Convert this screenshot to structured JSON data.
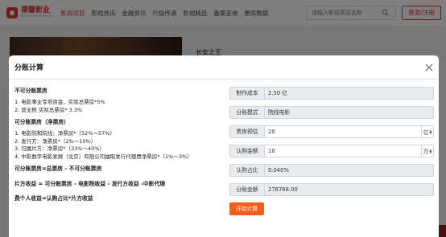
{
  "brand": {
    "name_cn": "德馨影业",
    "name_en": "DEXIN FILMS GROUP"
  },
  "nav": {
    "items": [
      {
        "label": "影视项目",
        "active": true
      },
      {
        "label": "影视资讯",
        "active": false
      },
      {
        "label": "金融资讯",
        "active": false
      },
      {
        "label": "行投传递",
        "active": false
      },
      {
        "label": "影视精选",
        "active": false
      },
      {
        "label": "备案查询",
        "active": false
      },
      {
        "label": "票房数据",
        "active": false
      }
    ],
    "search_placeholder": "请输入影视项目名称",
    "login_label": "登录/注册"
  },
  "background": {
    "project_title": "长安之王"
  },
  "modal": {
    "title": "分账计算",
    "sections": {
      "non_split_title": "不可分账票房",
      "non_split_lines": [
        "1. 电影事业专项资金，实际总票房*5%",
        "2. 营业税 实际总票房* 3.3%"
      ],
      "split_title": "可分账票房（净票房）",
      "split_lines": [
        "1. 电影院和院线：净票房*（52%～57%）",
        "2. 发行方：净票房*（2%～10%）",
        "3. 归属片方：净票房*（33%～40%）",
        "4. 中影数字电影发展（北京）有限公司抽取发行代理费净票房*（1%～3%）"
      ],
      "formula1": "可分账票房=总票房 - 不可分账票房",
      "formula2": "片方收益 = 可分账票房 - 电影院收益 - 发行方收益 -中影代理",
      "formula3": "费个人收益=认购占比*片方收益"
    },
    "form": {
      "cost_label": "制作成本",
      "cost_value": "2.50 亿",
      "mode_label": "分账模式",
      "mode_value": "院线电影",
      "box_label": "票房预估",
      "box_value": "20",
      "box_unit": "亿",
      "subscribe_label": "认购金额",
      "subscribe_value": "10",
      "subscribe_unit": "万",
      "ratio_label": "认购占比",
      "ratio_value": "0.040%",
      "split_amount_label": "分账金额",
      "split_amount_value": "278768.00",
      "start_label": "开始计算"
    }
  },
  "colors": {
    "accent": "#d8342a",
    "button": "#fd5a1e"
  }
}
